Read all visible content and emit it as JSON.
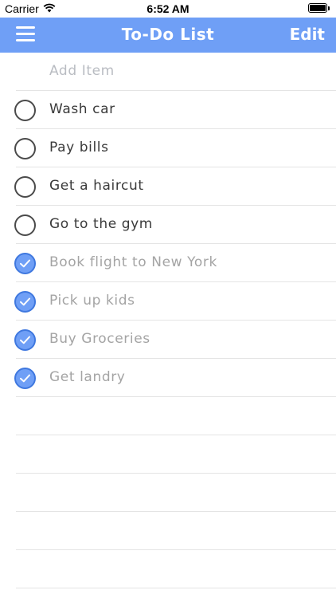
{
  "status_bar": {
    "carrier": "Carrier",
    "time": "6:52 AM"
  },
  "nav": {
    "title": "To-Do List",
    "edit_label": "Edit",
    "menu_icon": "hamburger-icon"
  },
  "add_item": {
    "placeholder": "Add Item"
  },
  "tasks": [
    {
      "text": "Wash car",
      "done": false
    },
    {
      "text": "Pay bills",
      "done": false
    },
    {
      "text": "Get a haircut",
      "done": false
    },
    {
      "text": "Go to the gym",
      "done": false
    },
    {
      "text": "Book flight to New York",
      "done": true
    },
    {
      "text": "Pick up kids",
      "done": true
    },
    {
      "text": "Buy Groceries",
      "done": true
    },
    {
      "text": "Get landry",
      "done": true
    }
  ],
  "colors": {
    "accent": "#6f9ff6",
    "check_border": "#3f78df",
    "done_text": "#a4a4a4"
  }
}
